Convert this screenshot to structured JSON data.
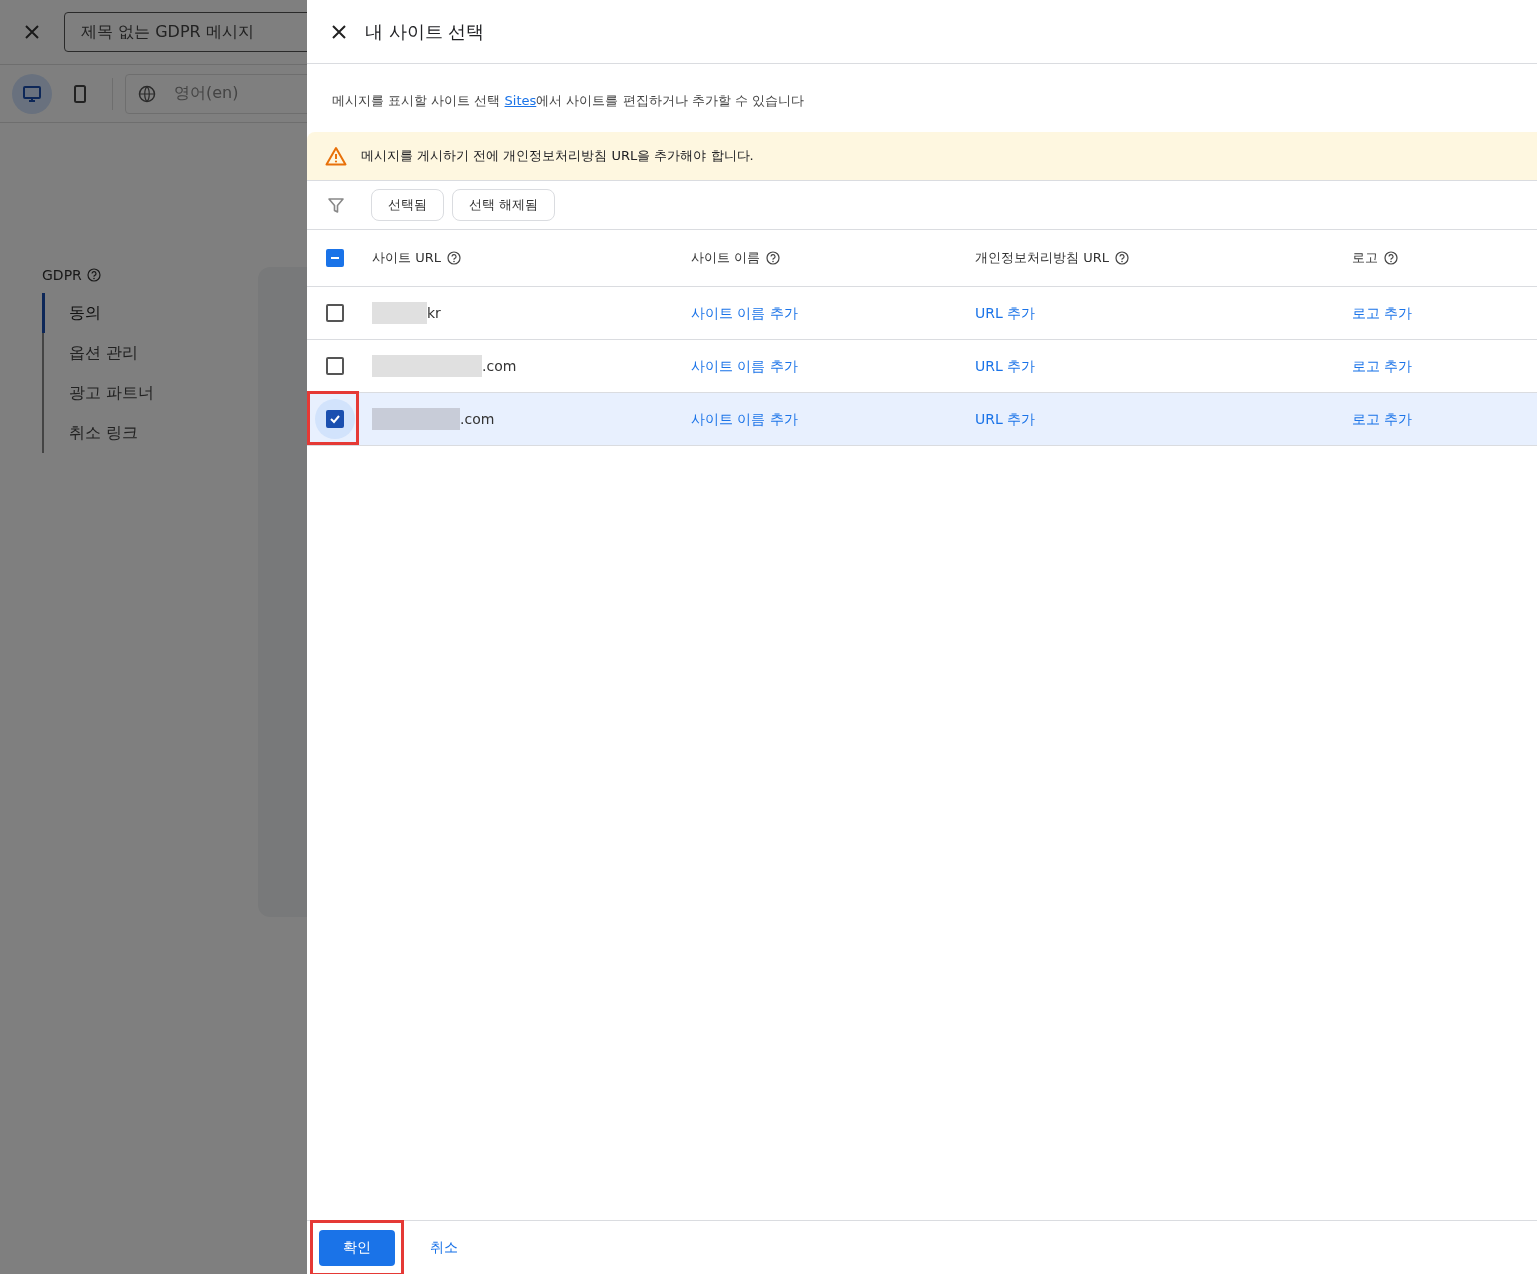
{
  "background": {
    "title_field": "제목 없는 GDPR 메시지",
    "devices": [
      {
        "kind": "desktop",
        "selected": true
      },
      {
        "kind": "mobile",
        "selected": false
      }
    ],
    "language_field": "영어(en)",
    "nav": {
      "heading": "GDPR",
      "items": [
        {
          "label": "동의",
          "selected": true
        },
        {
          "label": "옵션 관리",
          "selected": false
        },
        {
          "label": "광고 파트너",
          "selected": false
        },
        {
          "label": "취소 링크",
          "selected": false
        }
      ]
    }
  },
  "panel": {
    "title": "내 사이트 선택",
    "description": {
      "before": "메시지를 표시할 사이트 선택 ",
      "link": "Sites",
      "after": "에서 사이트를 편집하거나 추가할 수 있습니다"
    },
    "warning": "메시지를 게시하기 전에 개인정보처리방침 URL을 추가해야 합니다.",
    "filters": [
      {
        "label": "선택됨",
        "selected": false
      },
      {
        "label": "선택 해제됨",
        "selected": false
      }
    ],
    "table": {
      "header_checkbox": {
        "indeterminate": true
      },
      "columns": [
        "사이트 URL",
        "사이트 이름",
        "개인정보처리방침 URL",
        "로고"
      ],
      "rows": [
        {
          "selected": false,
          "highlighted": false,
          "url_suffix": "kr",
          "site_name": "사이트 이름 추가",
          "privacy_url": "URL 추가",
          "logo": "로고 추가"
        },
        {
          "selected": false,
          "highlighted": false,
          "url_suffix": ".com",
          "site_name": "사이트 이름 추가",
          "privacy_url": "URL 추가",
          "logo": "로고 추가"
        },
        {
          "selected": true,
          "highlighted": true,
          "url_suffix": ".com",
          "site_name": "사이트 이름 추가",
          "privacy_url": "URL 추가",
          "logo": "로고 추가"
        }
      ]
    },
    "buttons": {
      "confirm": {
        "label": "확인",
        "highlighted": true
      },
      "cancel": "취소"
    }
  }
}
